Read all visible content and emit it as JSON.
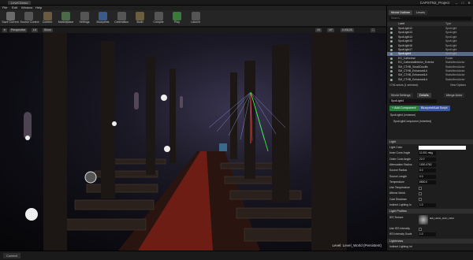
{
  "window": {
    "tab": "Level Demo",
    "project": "CAPSTN2_Project"
  },
  "menu": [
    "File",
    "Edit",
    "Window",
    "Help"
  ],
  "toolbar": [
    {
      "label": "Save Current",
      "icon": "save-icon",
      "color": "#6a6a6a"
    },
    {
      "label": "Source Control",
      "icon": "source-control-icon",
      "color": "#555"
    },
    {
      "label": "Content",
      "icon": "content-icon",
      "color": "#6a5a40"
    },
    {
      "label": "Marketplace",
      "icon": "marketplace-icon",
      "color": "#4a6a4a"
    },
    {
      "label": "Settings",
      "icon": "gear-icon",
      "color": "#555"
    },
    {
      "label": "Blueprints",
      "icon": "blueprint-icon",
      "color": "#3a5a8a"
    },
    {
      "label": "Cinematics",
      "icon": "cinematics-icon",
      "color": "#555"
    },
    {
      "label": "Build",
      "icon": "build-icon",
      "color": "#6a6040"
    },
    {
      "label": "Compile",
      "icon": "compile-icon",
      "color": "#555"
    },
    {
      "label": "Play",
      "icon": "play-icon",
      "color": "#3a7a3a"
    },
    {
      "label": "Launch",
      "icon": "launch-icon",
      "color": "#555"
    }
  ],
  "viewport": {
    "mode": "Perspective",
    "view": "Lit",
    "show": "Show",
    "label": "Level: Level_World (Persistent)",
    "grid": "10",
    "angle": "10°",
    "scale": "0.03125"
  },
  "outliner": {
    "tab": "World Outliner",
    "tab2": "Levels",
    "search_placeholder": "Search...",
    "columns": [
      "Label",
      "Type"
    ],
    "rows": [
      {
        "name": "SpotLight12",
        "type": "SpotLight",
        "sel": false
      },
      {
        "name": "SpotLight13",
        "type": "SpotLight",
        "sel": false
      },
      {
        "name": "SpotLight14",
        "type": "SpotLight",
        "sel": false
      },
      {
        "name": "SpotLight15",
        "type": "SpotLight",
        "sel": false
      },
      {
        "name": "SpotLight16",
        "type": "SpotLight",
        "sel": false
      },
      {
        "name": "SpotLight17",
        "type": "SpotLight",
        "sel": false
      },
      {
        "name": "SpotLight4",
        "type": "SpotLight",
        "sel": true
      },
      {
        "name": "EG_Cathedral",
        "type": "Folder",
        "sel": false
      },
      {
        "name": "EG_CathedralInterior_Exterior",
        "type": "StaticMeshActor",
        "sel": false
      },
      {
        "name": "SM_CTHB_SmallCrucifix",
        "type": "StaticMeshActor",
        "sel": false
      },
      {
        "name": "SM_CTHB_EnhancedLit",
        "type": "StaticMeshActor",
        "sel": false
      },
      {
        "name": "SM_CTHB_EnhancedLit",
        "type": "StaticMeshActor",
        "sel": false
      },
      {
        "name": "SM_CTHB_EnhancedLit",
        "type": "StaticMeshActor",
        "sel": false
      }
    ],
    "count": "1746 actors (1 selected)",
    "view_options": "View Options"
  },
  "details": {
    "tabs": [
      "World Settings",
      "Details",
      "Merge Actor"
    ],
    "name": "SpotLight4",
    "add_component": "+ Add Component",
    "blueprint": "Blueprint/Add Script",
    "components": [
      "SpotLight4 (Instance)",
      "SpotLightComponent (Inherited)"
    ],
    "section_light": "Light",
    "props": [
      {
        "label": "Light Color",
        "value": "",
        "type": "color"
      },
      {
        "label": "Inner Cone Angle",
        "value": "11.001 mkg",
        "type": "text"
      },
      {
        "label": "Outer Cone Angle",
        "value": "22.0",
        "type": "text"
      },
      {
        "label": "Attenuation Radius",
        "value": "1000.4762",
        "type": "text"
      },
      {
        "label": "Source Radius",
        "value": "0.0",
        "type": "text"
      },
      {
        "label": "Source Length",
        "value": "0.0",
        "type": "text"
      },
      {
        "label": "Temperature",
        "value": "6500.0",
        "type": "text"
      },
      {
        "label": "Use Temperature",
        "value": "",
        "type": "check"
      },
      {
        "label": "Affects World",
        "value": "",
        "type": "check"
      },
      {
        "label": "Cast Shadows",
        "value": "",
        "type": "check"
      },
      {
        "label": "Indirect Lighting In",
        "value": "1.0",
        "type": "text"
      }
    ],
    "section_profiles": "Light Profiles",
    "ies_texture": "IES Texture",
    "ies_value": "IES_HANL_DAC_2014",
    "use_ies": "Use IES Intensity",
    "ies_intensity": "IES Intensity Scale",
    "ies_scale": "1.0",
    "section_lightmass": "Lightmass",
    "indirect": "Indirect Lighting Int"
  },
  "bottom": {
    "content_browser": "Content"
  }
}
